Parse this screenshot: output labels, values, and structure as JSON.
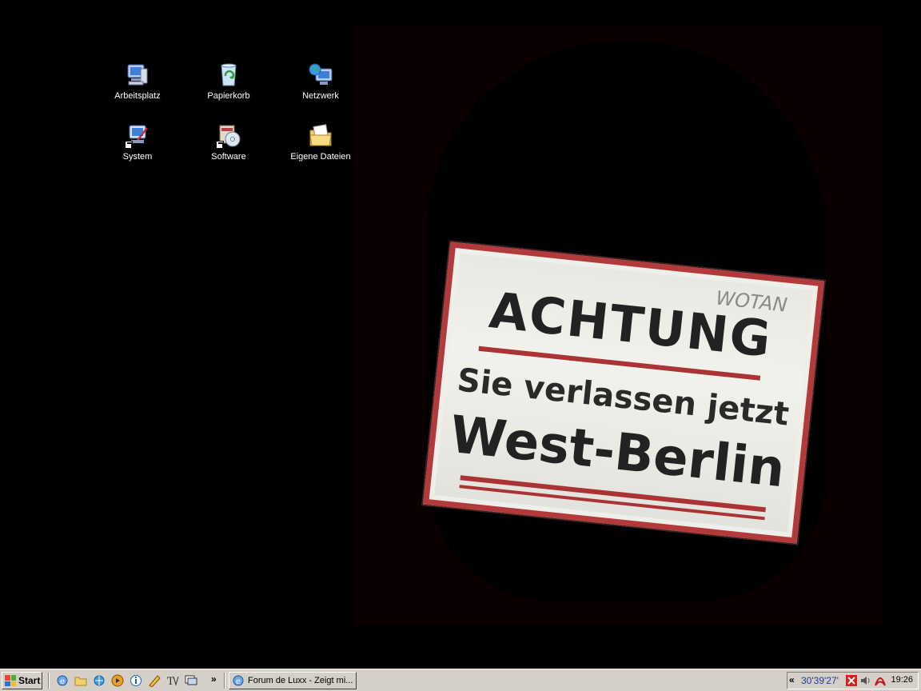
{
  "desktop": {
    "icons": [
      {
        "label": "Arbeitsplatz"
      },
      {
        "label": "Papierkorb"
      },
      {
        "label": "Netzwerk"
      },
      {
        "label": "System"
      },
      {
        "label": "Software"
      },
      {
        "label": "Eigene Dateien"
      }
    ],
    "wallpaper": {
      "line1": "ACHTUNG",
      "line2": "Sie verlassen jetzt",
      "line3": "West-Berlin",
      "graffiti": "WOTAN"
    }
  },
  "taskbar": {
    "start_label": "Start",
    "chevron": "»",
    "quicklaunch": [
      "ie-icon",
      "folder-icon",
      "browser-icon",
      "media-player-icon",
      "info-icon",
      "pencil-icon",
      "font-tool-icon",
      "monitor-icon"
    ],
    "task_button_label": "Forum de Luxx - Zeigt mi...",
    "tray": {
      "expand": "«",
      "coords": "30'39'27'",
      "clock": "19:26",
      "icons": [
        "antivirus-icon",
        "volume-icon",
        "acrobat-icon"
      ]
    }
  }
}
